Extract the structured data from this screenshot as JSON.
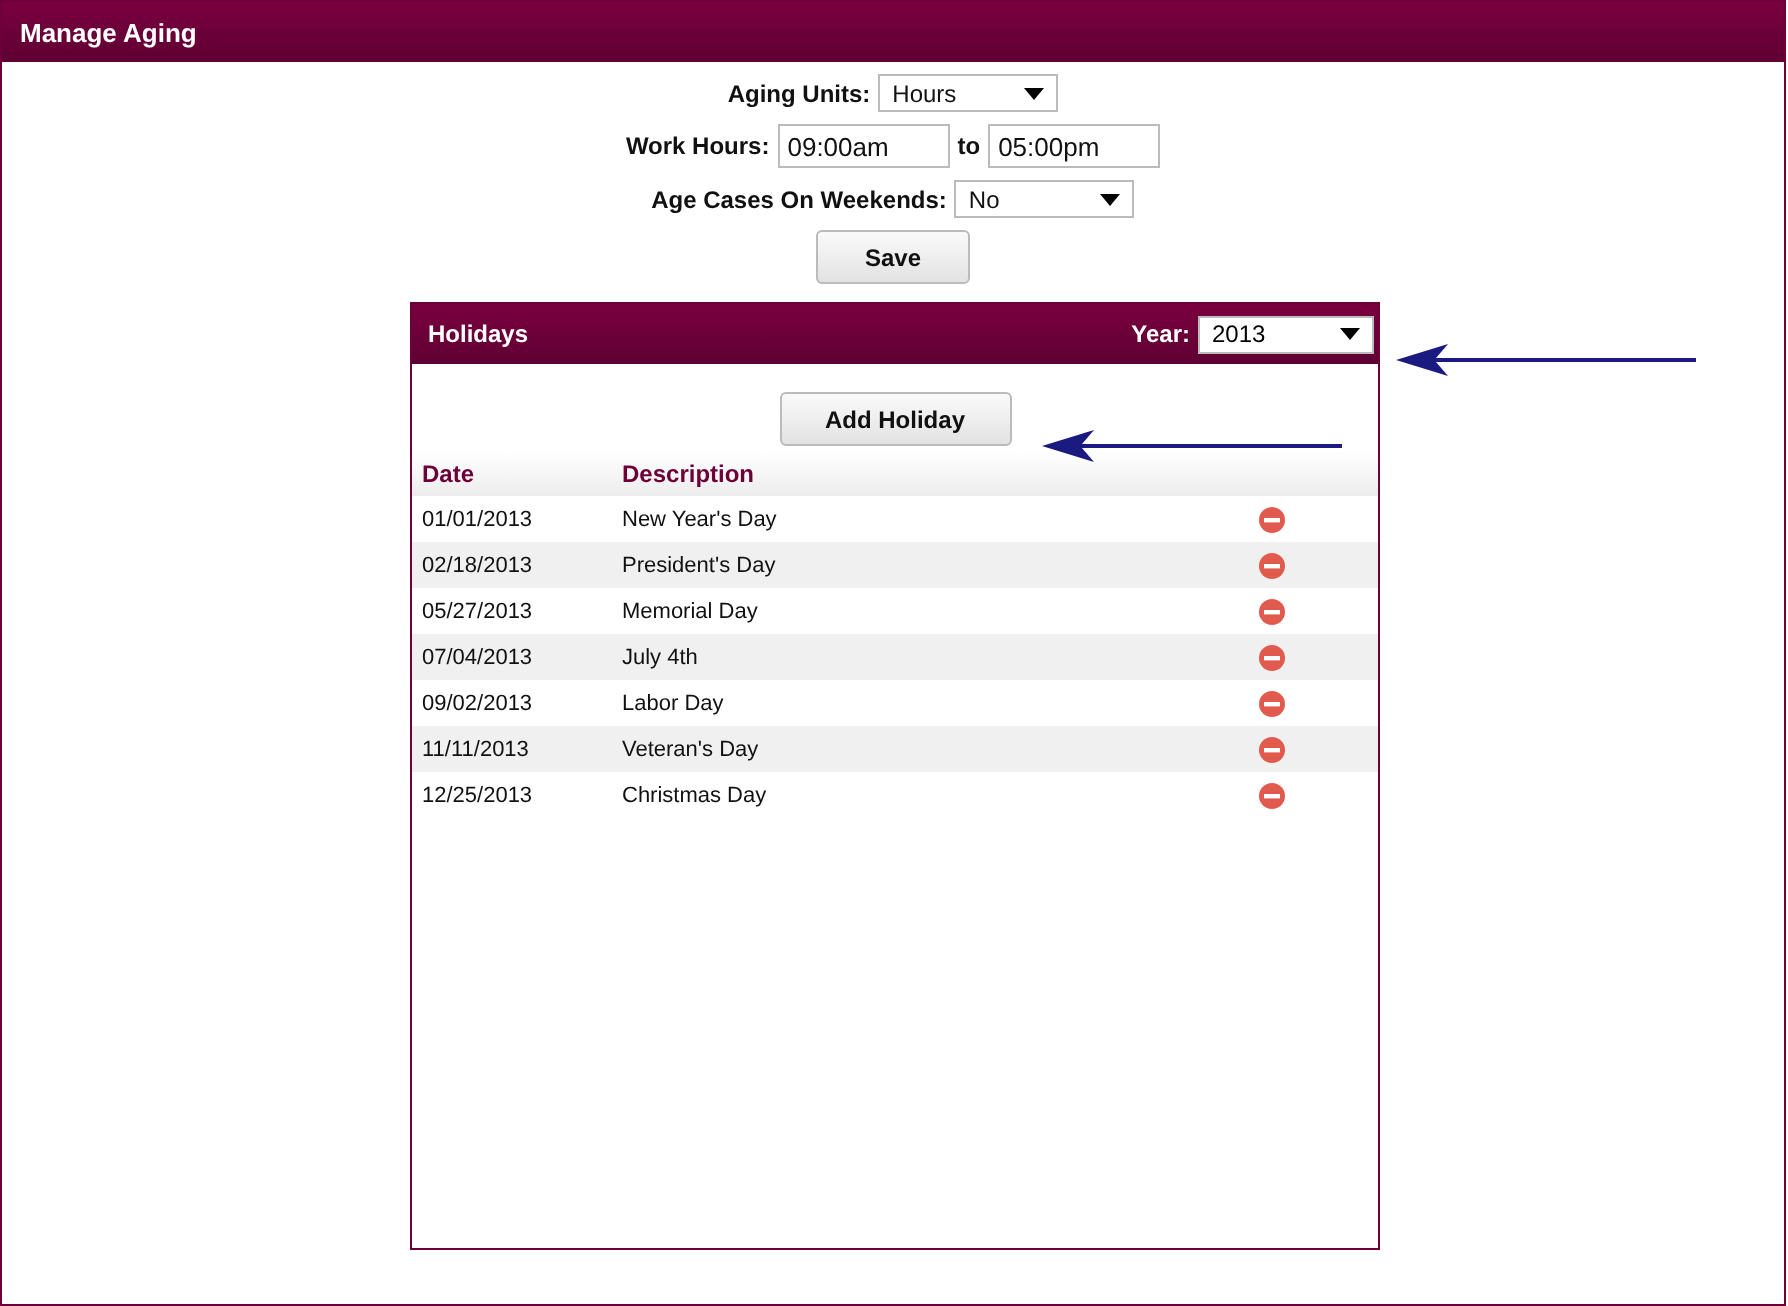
{
  "title": "Manage Aging",
  "aging_units": {
    "label": "Aging Units:",
    "value": "Hours"
  },
  "work_hours": {
    "label": "Work Hours:",
    "from": "09:00am",
    "separator": "to",
    "to": "05:00pm"
  },
  "weekends": {
    "label": "Age Cases On Weekends:",
    "value": "No"
  },
  "save_button": "Save",
  "holidays": {
    "title": "Holidays",
    "year_label": "Year:",
    "year": "2013",
    "add_button": "Add Holiday",
    "columns": [
      "Date",
      "Description"
    ],
    "rows": [
      {
        "date": "01/01/2013",
        "description": "New Year's Day"
      },
      {
        "date": "02/18/2013",
        "description": "President's Day"
      },
      {
        "date": "05/27/2013",
        "description": "Memorial Day"
      },
      {
        "date": "07/04/2013",
        "description": "July 4th"
      },
      {
        "date": "09/02/2013",
        "description": "Labor Day"
      },
      {
        "date": "11/11/2013",
        "description": "Veteran's Day"
      },
      {
        "date": "12/25/2013",
        "description": "Christmas Day"
      }
    ]
  }
}
